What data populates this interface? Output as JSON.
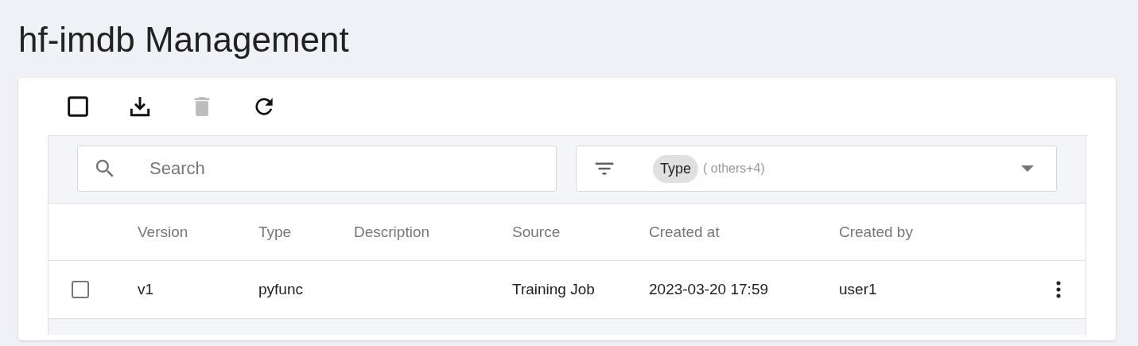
{
  "page": {
    "title": "hf-imdb Management"
  },
  "toolbar": [
    {
      "kind": "select-all",
      "checked": false,
      "disabled": false
    },
    {
      "kind": "download",
      "disabled": false
    },
    {
      "kind": "delete",
      "disabled": true
    },
    {
      "kind": "refresh",
      "disabled": false
    }
  ],
  "search": {
    "placeholder": "Search"
  },
  "filter": {
    "chip": "Type",
    "extra": "( others+4)"
  },
  "table": {
    "columns": [
      "Version",
      "Type",
      "Description",
      "Source",
      "Created at",
      "Created by"
    ],
    "rows": [
      {
        "checked": false,
        "cells": [
          "v1",
          "pyfunc",
          "",
          "Training Job",
          "2023-03-20 17:59",
          "user1"
        ]
      }
    ]
  }
}
